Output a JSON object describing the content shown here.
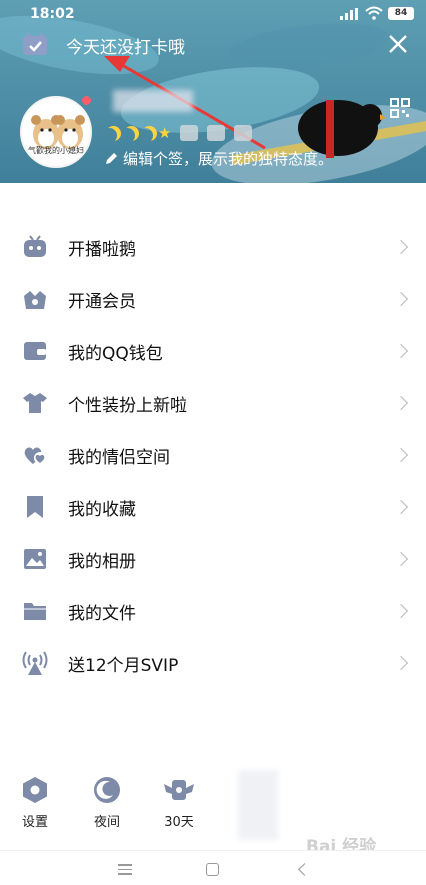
{
  "status_bar": {
    "time": "18:02",
    "battery": "84"
  },
  "header": {
    "checkin_text": "今天还没打卡哦",
    "avatar_caption": "气歡我的小媳妇",
    "signature": "编辑个签，展示我的独特态度。",
    "level": {
      "moons": 3,
      "stars": 1
    },
    "accent_color": "#e63935"
  },
  "menu": {
    "items": [
      {
        "label": "开播啦鹅",
        "icon": "tv-robot-icon"
      },
      {
        "label": "开通会员",
        "icon": "crown-bag-icon"
      },
      {
        "label": "我的QQ钱包",
        "icon": "wallet-icon"
      },
      {
        "label": "个性装扮上新啦",
        "icon": "tshirt-icon"
      },
      {
        "label": "我的情侣空间",
        "icon": "hearts-icon"
      },
      {
        "label": "我的收藏",
        "icon": "bookmark-icon"
      },
      {
        "label": "我的相册",
        "icon": "photo-icon"
      },
      {
        "label": "我的文件",
        "icon": "folder-icon"
      },
      {
        "label": "送12个月SVIP",
        "icon": "broadcast-icon"
      }
    ],
    "icon_color": "#7d8aa8"
  },
  "bottom_tools": {
    "settings_label": "设置",
    "night_label": "夜间",
    "days_label": "30天"
  },
  "watermark": "Bai 经验"
}
